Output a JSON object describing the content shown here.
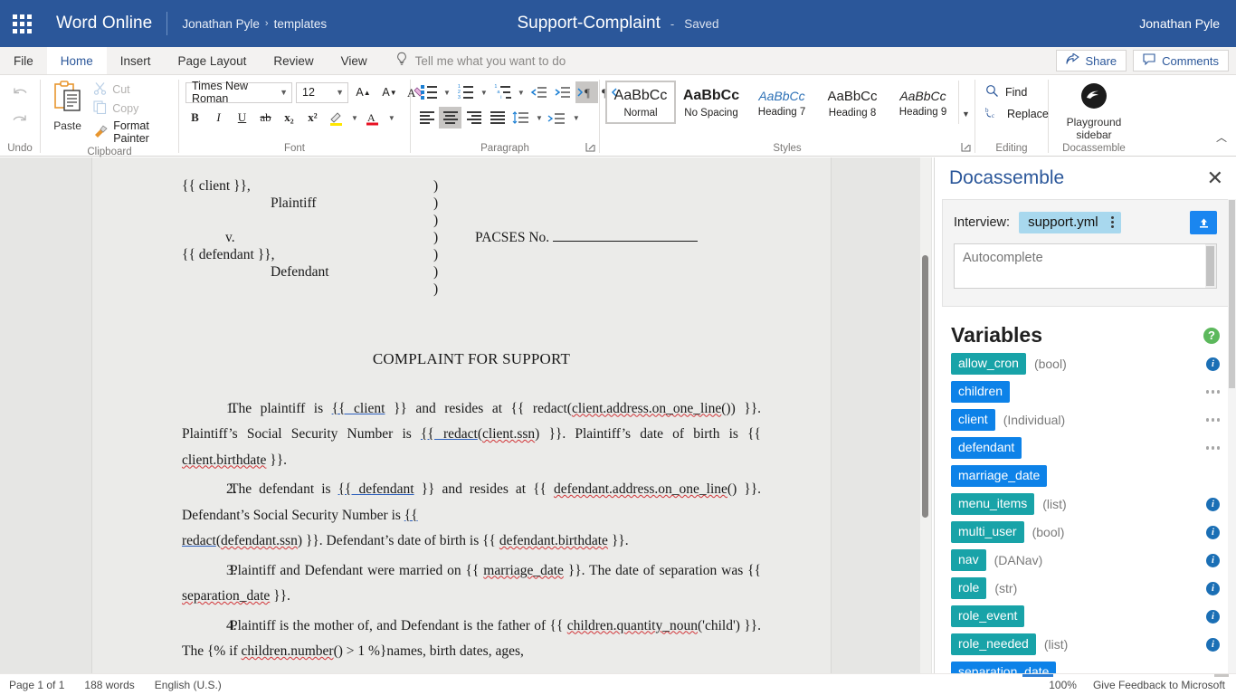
{
  "topbar": {
    "waffle_icon": "app-launcher-icon",
    "app_name": "Word Online",
    "breadcrumb_user": "Jonathan Pyle",
    "breadcrumb_sep": "›",
    "breadcrumb_folder": "templates",
    "document_title": "Support-Complaint",
    "title_dash": "-",
    "save_state": "Saved",
    "user_name": "Jonathan Pyle"
  },
  "tabs": [
    {
      "label": "File",
      "active": false
    },
    {
      "label": "Home",
      "active": true
    },
    {
      "label": "Insert",
      "active": false
    },
    {
      "label": "Page Layout",
      "active": false
    },
    {
      "label": "Review",
      "active": false
    },
    {
      "label": "View",
      "active": false
    }
  ],
  "tellme": {
    "icon": "lightbulb-icon",
    "placeholder": "Tell me what you want to do"
  },
  "tabrow_right": [
    {
      "label": "Share",
      "icon": "share-icon"
    },
    {
      "label": "Comments",
      "icon": "comment-icon"
    }
  ],
  "ribbon": {
    "undo": {
      "group_label": "Undo",
      "undo_icon": "undo-arrow-icon",
      "redo_icon": "redo-arrow-icon"
    },
    "clipboard": {
      "group_label": "Clipboard",
      "paste_label": "Paste",
      "paste_icon": "clipboard-icon",
      "items": [
        {
          "label": "Cut",
          "icon": "scissors-icon",
          "disabled": true
        },
        {
          "label": "Copy",
          "icon": "copy-icon",
          "disabled": true
        },
        {
          "label": "Format Painter",
          "icon": "paintbrush-icon",
          "disabled": false
        }
      ]
    },
    "font": {
      "group_label": "Font",
      "font_family": "Times New Roman",
      "font_size": "12",
      "grow_icon": "grow-font-icon",
      "shrink_icon": "shrink-font-icon",
      "clear_format_icon": "clear-formatting-icon",
      "bold": "B",
      "italic": "I",
      "underline": "U",
      "strikethrough": "ab",
      "subscript": "x₂",
      "superscript": "x²",
      "highlight_icon": "text-highlight-icon",
      "font_color": "A"
    },
    "paragraph": {
      "group_label": "Paragraph",
      "bullets_icon": "bullet-list-icon",
      "numbering_icon": "numbered-list-icon",
      "multilevel_icon": "multilevel-list-icon",
      "decrease_indent_icon": "decrease-indent-icon",
      "increase_indent_icon": "increase-indent-icon",
      "ltr_icon": "left-to-right-icon",
      "rtl_icon": "right-to-left-icon",
      "align_left_icon": "align-left-icon",
      "align_center_icon": "align-center-icon",
      "align_right_icon": "align-right-icon",
      "justify_icon": "justify-icon",
      "line_spacing_icon": "line-spacing-icon",
      "paragraph_spacing_icon": "paragraph-spacing-icon",
      "dialog_launcher_icon": "dialog-launcher-icon"
    },
    "styles": {
      "group_label": "Styles",
      "dialog_launcher_icon": "dialog-launcher-icon",
      "more_icon": "chevron-down-icon",
      "items": [
        {
          "preview": "AaBbCc",
          "name": "Normal",
          "selected": true,
          "style": "normal"
        },
        {
          "preview": "AaBbCc",
          "name": "No Spacing",
          "selected": false,
          "style": "nospacing"
        },
        {
          "preview": "AaBbCc",
          "name": "Heading 7",
          "selected": false,
          "style": "h7"
        },
        {
          "preview": "AaBbCc",
          "name": "Heading 8",
          "selected": false,
          "style": "h8"
        },
        {
          "preview": "AaBbCc",
          "name": "Heading 9",
          "selected": false,
          "style": "h9"
        }
      ]
    },
    "editing": {
      "group_label": "Editing",
      "items": [
        {
          "label": "Find",
          "icon": "magnifier-icon"
        },
        {
          "label": "Replace",
          "icon": "replace-icon"
        }
      ]
    },
    "docassemble": {
      "group_label": "Docassemble",
      "button_line1": "Playground",
      "button_line2": "sidebar",
      "icon": "docassemble-logo-icon"
    },
    "collapse_icon": "chevron-up-icon"
  },
  "document": {
    "caption": {
      "plaintiff_name": "{{ client }},",
      "plaintiff_label": "Plaintiff",
      "versus": "v.",
      "defendant_name": "{{ defendant }},",
      "defendant_label": "Defendant",
      "paren": ")",
      "pacses_label": "PACSES No."
    },
    "heading": "COMPLAINT FOR SUPPORT",
    "paragraphs": [
      {
        "number": "1.",
        "text": "The plaintiff is {{ client }} and resides at {{ redact(client.address.on_one_line()) }}. Plaintiff’s Social Security Number is {{ redact(client.ssn) }}. Plaintiff’s date of birth is {{ client.birthdate }}."
      },
      {
        "number": "2.",
        "text": "The defendant is {{ defendant }} and resides at {{ defendant.address.on_one_line() }}. Defendant’s Social Security Number is {{ redact(defendant.ssn) }}. Defendant’s date of birth is {{ defendant.birthdate }}."
      },
      {
        "number": "3.",
        "text": "Plaintiff and Defendant were married on {{ marriage_date }}. The date of separation was {{ separation_date }}."
      },
      {
        "number": "4.",
        "text": "Plaintiff is the mother of, and Defendant is the father of {{ children.quantity_noun('child') }}. The {% if children.number() > 1 %}names, birth dates, ages,"
      }
    ]
  },
  "sidebar": {
    "title": "Docassemble",
    "close_icon": "close-icon",
    "interview_label": "Interview:",
    "interview_value": "support.yml",
    "interview_menu_icon": "kebab-menu-icon",
    "upload_icon": "upload-icon",
    "autocomplete_placeholder": "Autocomplete",
    "autocomplete_value": "",
    "variables_title": "Variables",
    "help_icon": "help-icon",
    "variables": [
      {
        "name": "allow_cron",
        "type": "(bool)",
        "color": "#18a3a8",
        "action": "info"
      },
      {
        "name": "children",
        "type": "",
        "color": "#0d82e8",
        "action": "ellipsis"
      },
      {
        "name": "client",
        "type": "(Individual)",
        "color": "#0d82e8",
        "action": "ellipsis"
      },
      {
        "name": "defendant",
        "type": "",
        "color": "#0d82e8",
        "action": "ellipsis"
      },
      {
        "name": "marriage_date",
        "type": "",
        "color": "#0d82e8",
        "action": "none"
      },
      {
        "name": "menu_items",
        "type": "(list)",
        "color": "#18a3a8",
        "action": "info"
      },
      {
        "name": "multi_user",
        "type": "(bool)",
        "color": "#18a3a8",
        "action": "info"
      },
      {
        "name": "nav",
        "type": "(DANav)",
        "color": "#18a3a8",
        "action": "info"
      },
      {
        "name": "role",
        "type": "(str)",
        "color": "#18a3a8",
        "action": "info"
      },
      {
        "name": "role_event",
        "type": "",
        "color": "#18a3a8",
        "action": "info"
      },
      {
        "name": "role_needed",
        "type": "(list)",
        "color": "#18a3a8",
        "action": "info"
      },
      {
        "name": "separation_date",
        "type": "",
        "color": "#0d82e8",
        "action": "none"
      }
    ]
  },
  "statusbar": {
    "page": "Page 1 of 1",
    "words": "188 words",
    "language": "English (U.S.)",
    "zoom": "100%",
    "feedback": "Give Feedback to Microsoft"
  },
  "colors": {
    "brand_blue": "#2b579a",
    "accent_blue": "#0d82e8",
    "teal": "#18a3a8",
    "chip_blue": "#a8d8ee",
    "green": "#5cb85c"
  }
}
